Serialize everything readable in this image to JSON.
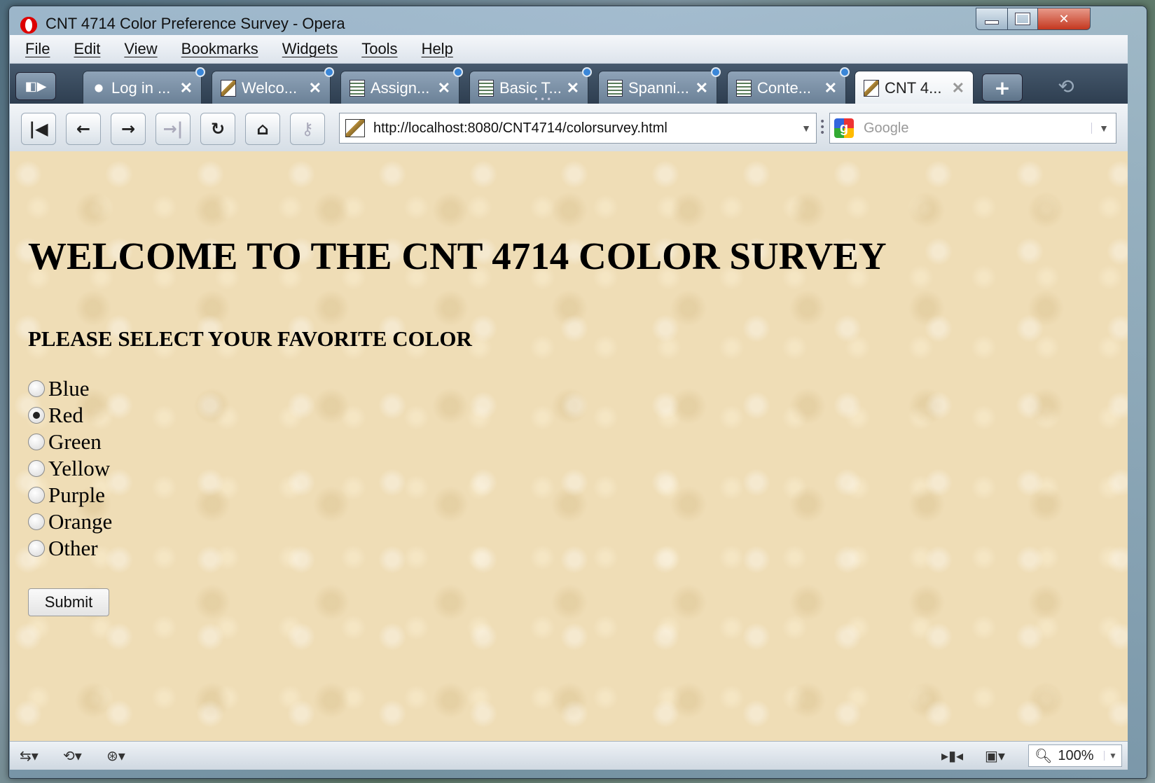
{
  "window": {
    "title": "CNT 4714 Color Preference Survey - Opera"
  },
  "menu": [
    "File",
    "Edit",
    "View",
    "Bookmarks",
    "Widgets",
    "Tools",
    "Help"
  ],
  "tabs": [
    {
      "label": "Log in ...",
      "icon": "sun-icon"
    },
    {
      "label": "Welco...",
      "icon": "image-icon"
    },
    {
      "label": "Assign...",
      "icon": "document-icon"
    },
    {
      "label": "Basic T...",
      "icon": "document-icon"
    },
    {
      "label": "Spanni...",
      "icon": "document-icon"
    },
    {
      "label": "Conte...",
      "icon": "document-icon"
    },
    {
      "label": "CNT 4...",
      "icon": "image-icon",
      "active": true
    }
  ],
  "address": {
    "url": "http://localhost:8080/CNT4714/colorsurvey.html"
  },
  "search": {
    "placeholder": "Google"
  },
  "page": {
    "heading": "WELCOME TO THE CNT 4714 COLOR SURVEY",
    "subheading": "PLEASE SELECT YOUR FAVORITE COLOR",
    "options": [
      "Blue",
      "Red",
      "Green",
      "Yellow",
      "Purple",
      "Orange",
      "Other"
    ],
    "selected": "Red",
    "submit_label": "Submit"
  },
  "status": {
    "zoom": "100%"
  },
  "colors": {
    "page_background": "#efddb6",
    "tab_bar": "#3b4d60",
    "close_button": "#c4371f"
  }
}
